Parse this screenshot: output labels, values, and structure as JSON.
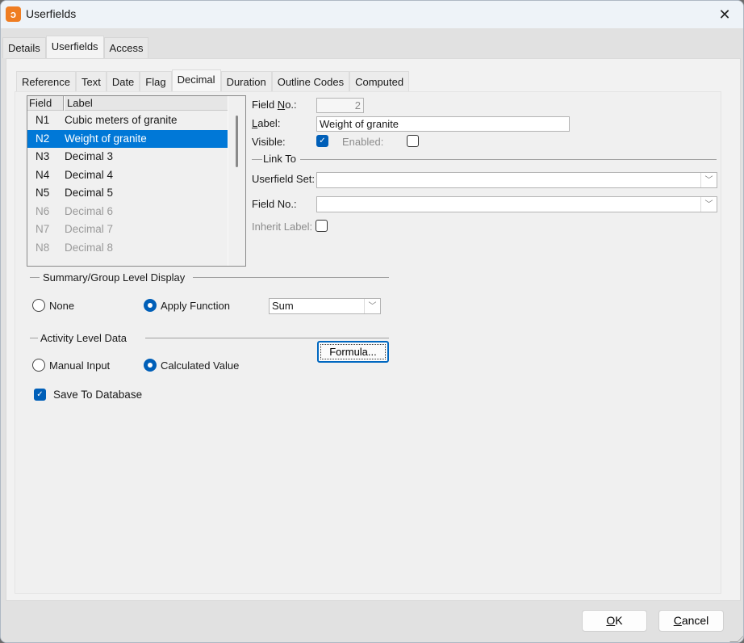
{
  "window": {
    "title": "Userfields",
    "icon": "app-logo-icon",
    "close_label": "✕"
  },
  "outer_tabs": [
    {
      "label": "Details",
      "active": false
    },
    {
      "label": "Userfields",
      "active": true
    },
    {
      "label": "Access",
      "active": false
    }
  ],
  "inner_tabs": [
    {
      "label": "Reference",
      "active": false
    },
    {
      "label": "Text",
      "active": false
    },
    {
      "label": "Date",
      "active": false
    },
    {
      "label": "Flag",
      "active": false
    },
    {
      "label": "Decimal",
      "active": true
    },
    {
      "label": "Duration",
      "active": false
    },
    {
      "label": "Outline Codes",
      "active": false
    },
    {
      "label": "Computed",
      "active": false
    }
  ],
  "field_list": {
    "columns": [
      "Field",
      "Label"
    ],
    "rows": [
      {
        "field": "N1",
        "label": "Cubic meters of granite",
        "state": "normal"
      },
      {
        "field": "N2",
        "label": "Weight of granite",
        "state": "selected"
      },
      {
        "field": "N3",
        "label": "Decimal 3",
        "state": "normal"
      },
      {
        "field": "N4",
        "label": "Decimal 4",
        "state": "normal"
      },
      {
        "field": "N5",
        "label": "Decimal 5",
        "state": "normal"
      },
      {
        "field": "N6",
        "label": "Decimal 6",
        "state": "disabled"
      },
      {
        "field": "N7",
        "label": "Decimal 7",
        "state": "disabled"
      },
      {
        "field": "N8",
        "label": "Decimal 8",
        "state": "disabled"
      }
    ]
  },
  "details": {
    "field_no_label_pre": "Field ",
    "field_no_label_u": "N",
    "field_no_label_post": "o.:",
    "field_no_value": "2",
    "label_label_u": "L",
    "label_label_post": "abel:",
    "label_value": "Weight of granite",
    "visible_label": "Visible:",
    "visible_checked": true,
    "enabled_label": "Enabled:",
    "enabled_checked": false
  },
  "link_to": {
    "group_title": "Link To",
    "userfield_set_label": "Userfield Set:",
    "userfield_set_value": "",
    "field_no_label": "Field No.:",
    "field_no_value": "",
    "inherit_label": "Inherit Label:",
    "inherit_checked": false
  },
  "summary": {
    "group_title": "Summary/Group Level Display",
    "none_label": "None",
    "apply_label": "Apply Function",
    "selected": "apply",
    "function_value": "Sum"
  },
  "activity": {
    "group_title": "Activity Level Data",
    "manual_label": "Manual Input",
    "calculated_label": "Calculated Value",
    "selected": "calculated",
    "formula_button": "Formula...",
    "save_label": "Save To Database",
    "save_checked": true
  },
  "footer": {
    "ok_u": "O",
    "ok_rest": "K",
    "cancel_u": "C",
    "cancel_rest": "ancel"
  }
}
